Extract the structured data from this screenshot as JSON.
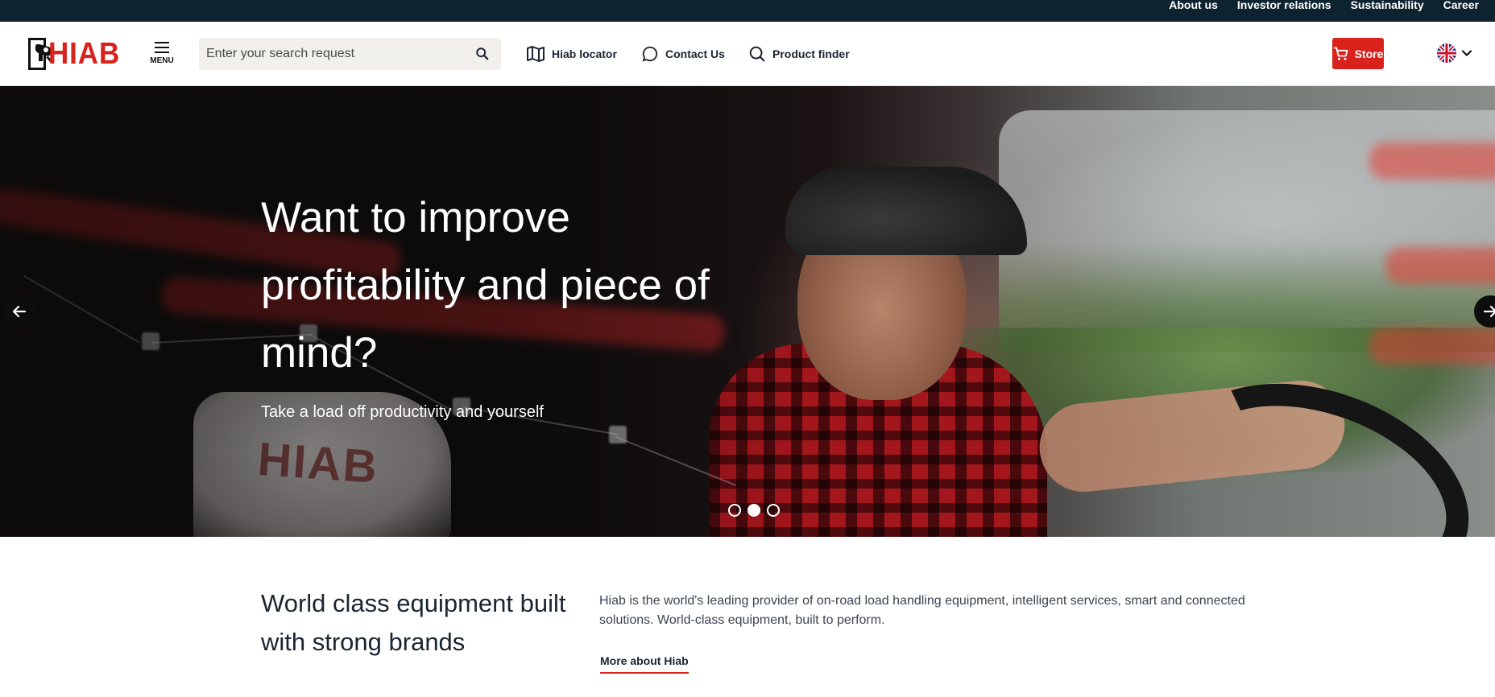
{
  "topbar": {
    "links": [
      "About us",
      "Investor relations",
      "Sustainability",
      "Career"
    ]
  },
  "header": {
    "logo_text": "HIAB",
    "menu_label": "MENU",
    "search_placeholder": "Enter your search request",
    "nav": {
      "locator": "Hiab locator",
      "contact": "Contact Us",
      "finder": "Product finder"
    },
    "store_label": "Store",
    "language_icon": "uk-flag-icon"
  },
  "hero": {
    "title": "Want to improve profitability and piece of mind?",
    "subtitle": "Take a load off productivity and yourself",
    "slides_total": 3,
    "active_slide": 2
  },
  "intro": {
    "title": "World class equipment built with strong brands",
    "text": "Hiab is the world's leading provider of on-road load handling equipment, intelligent services, smart and connected solutions. World-class equipment, built to perform.",
    "link": "More about Hiab"
  },
  "colors": {
    "brand_red": "#d9221c",
    "topbar": "#0e2330",
    "text_dark": "#1b2530"
  }
}
